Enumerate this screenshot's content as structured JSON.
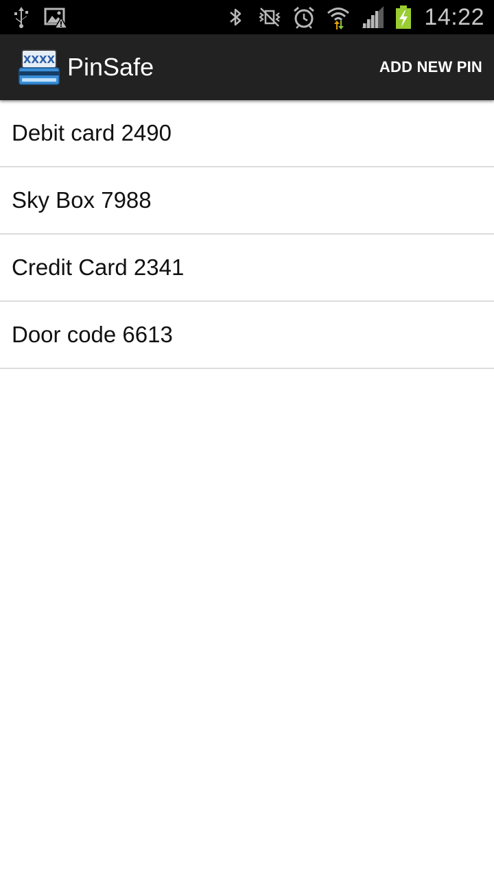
{
  "status_bar": {
    "time": "14:22",
    "left_icons": [
      "usb-icon",
      "image-warning-icon"
    ],
    "right_icons": [
      "bluetooth-icon",
      "vibrate-mute-icon",
      "alarm-icon",
      "wifi-icon",
      "signal-icon",
      "battery-charging-icon"
    ]
  },
  "action_bar": {
    "title": "PinSafe",
    "app_icon_text": "XXXX",
    "add_button_label": "ADD NEW PIN"
  },
  "pins": [
    {
      "label": "Debit card 2490"
    },
    {
      "label": "Sky Box 7988"
    },
    {
      "label": "Credit Card 2341"
    },
    {
      "label": "Door code 6613"
    }
  ],
  "colors": {
    "status_bar_bg": "#000000",
    "action_bar_bg": "#222222",
    "list_bg": "#ffffff",
    "divider": "#dcdcdc",
    "battery_green": "#9acd32"
  }
}
